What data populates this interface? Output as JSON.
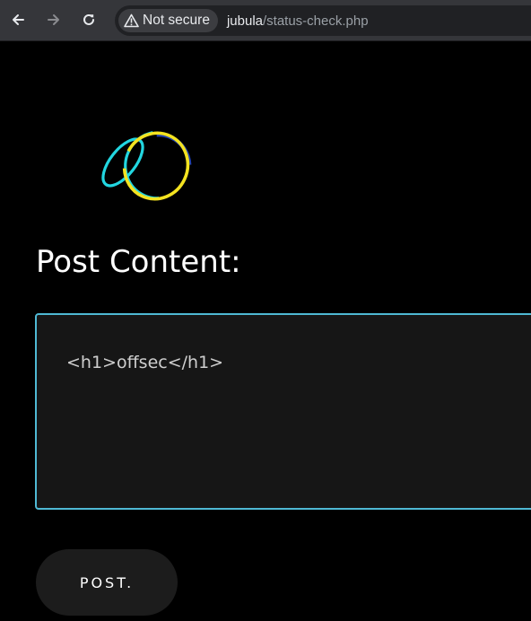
{
  "browser": {
    "security_label": "Not secure",
    "url_host": "jubula",
    "url_path": "/status-check.php",
    "icons": {
      "back": "arrow-left-icon",
      "forward": "arrow-right-icon",
      "reload": "reload-icon",
      "security": "warning-triangle-icon"
    }
  },
  "page": {
    "title": "Post Content:",
    "content_value": "<h1>offsec</h1>",
    "submit_label": "POST."
  },
  "colors": {
    "background": "#000000",
    "accent_border": "#4fb9d4",
    "logo_cyan": "#22d6e0",
    "logo_yellow": "#f4e320",
    "logo_blue": "#1f3fb0"
  }
}
